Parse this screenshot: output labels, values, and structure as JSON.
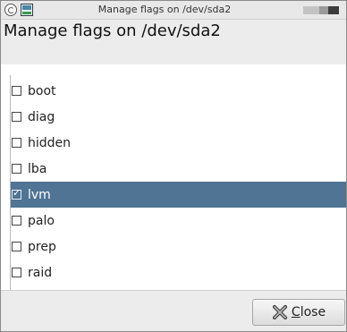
{
  "window": {
    "title": "Manage flags on /dev/sda2"
  },
  "dialog": {
    "heading": "Manage flags on /dev/sda2"
  },
  "flags": [
    {
      "label": "boot",
      "checked": false
    },
    {
      "label": "diag",
      "checked": false
    },
    {
      "label": "hidden",
      "checked": false
    },
    {
      "label": "lba",
      "checked": false
    },
    {
      "label": "lvm",
      "checked": true
    },
    {
      "label": "palo",
      "checked": false
    },
    {
      "label": "prep",
      "checked": false
    },
    {
      "label": "raid",
      "checked": false
    }
  ],
  "footer": {
    "close_mnemonic": "C",
    "close_rest": "lose"
  },
  "colors": {
    "selection": "#4f7494",
    "window_bg": "#ececec"
  },
  "icons": {
    "window_menu": "window-menu-icon",
    "app": "gparted-app-icon",
    "close": "close-x-icon"
  }
}
